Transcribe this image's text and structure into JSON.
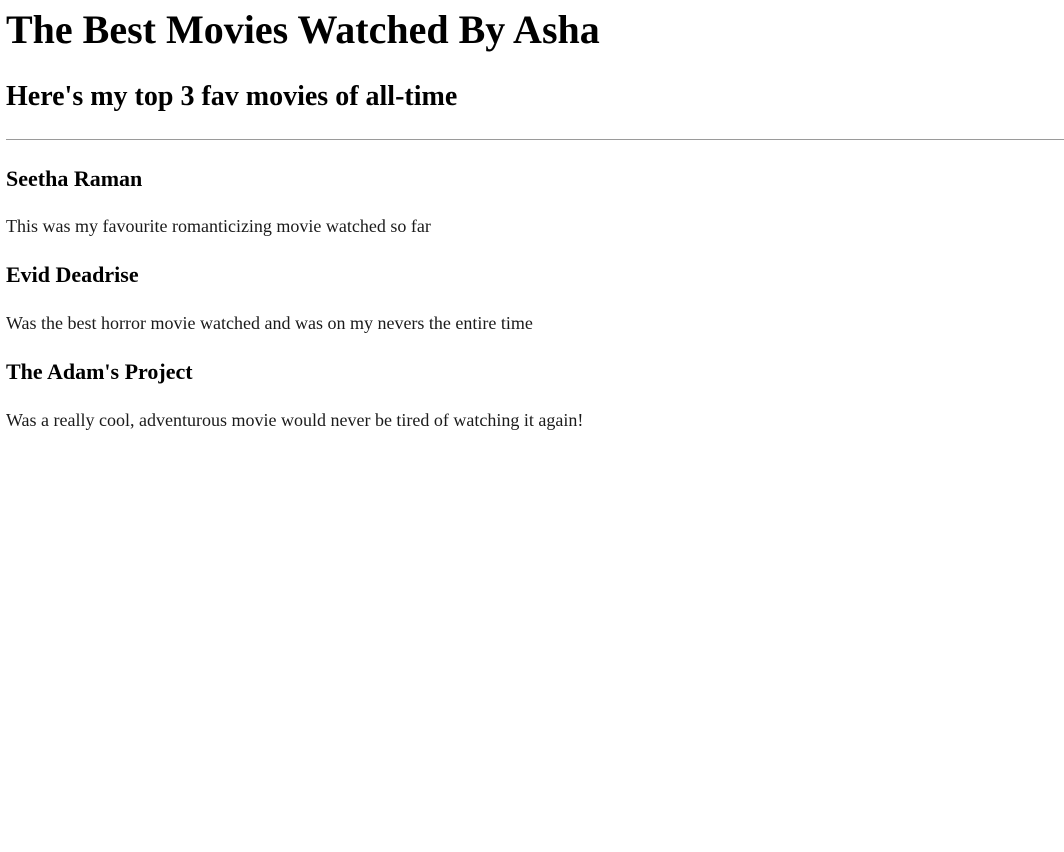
{
  "header": {
    "title": "The Best Movies Watched By Asha",
    "subtitle": "Here's my top 3 fav movies of all-time"
  },
  "movies": [
    {
      "title": "Seetha Raman",
      "description": "This was my favourite romanticizing movie watched so far"
    },
    {
      "title": "Evid Deadrise",
      "description": "Was the best horror movie watched and was on my nevers the entire time"
    },
    {
      "title": "The Adam's Project",
      "description": "Was a really cool, adventurous movie would never be tired of watching it again!"
    }
  ],
  "colors": {
    "background": "#ffffff",
    "text": "#000000",
    "divider": "#9a9a9a"
  }
}
